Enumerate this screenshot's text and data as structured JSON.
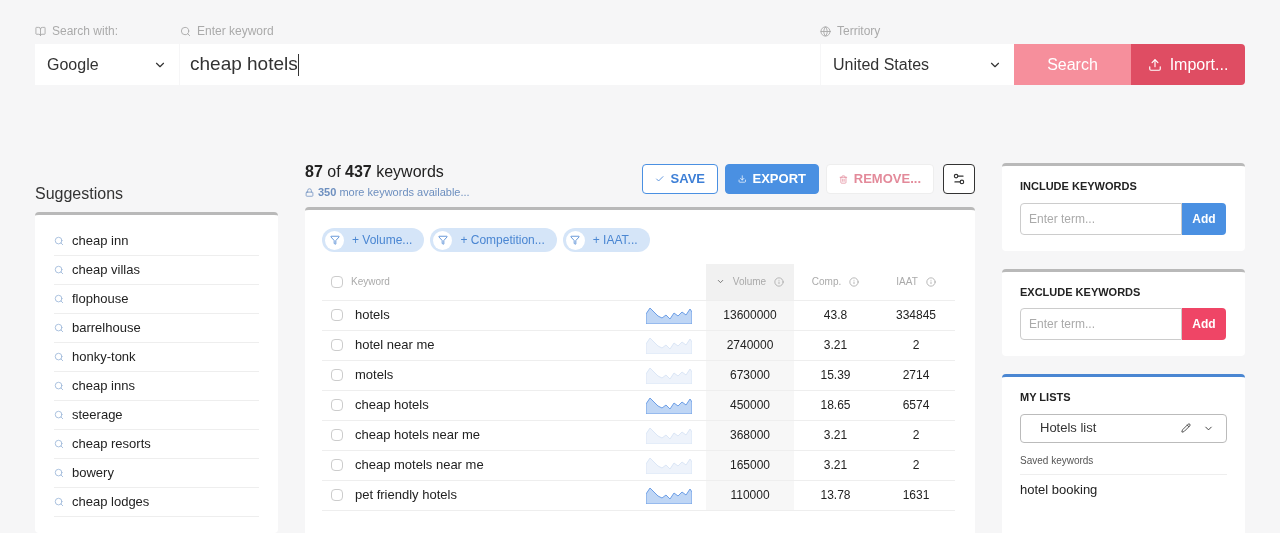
{
  "search_bar": {
    "engine_label": "Search with:",
    "engine": "Google",
    "keyword_label": "Enter keyword",
    "keyword": "cheap hotels",
    "territory_label": "Territory",
    "territory": "United States",
    "search_button": "Search",
    "import_button": "Import..."
  },
  "suggestions": {
    "title": "Suggestions",
    "items": [
      "cheap inn",
      "cheap villas",
      "flophouse",
      "barrelhouse",
      "honky-tonk",
      "cheap inns",
      "steerage",
      "cheap resorts",
      "bowery",
      "cheap lodges"
    ]
  },
  "results": {
    "count": "87",
    "of": "of",
    "total": "437",
    "unit": "keywords",
    "more_count": "350",
    "more_text": "more keywords available...",
    "actions": [
      {
        "kind": "outline",
        "label": "SAVE",
        "disabled": false
      },
      {
        "kind": "solid",
        "label": "EXPORT",
        "disabled": false
      },
      {
        "kind": "delete",
        "label": "REMOVE...",
        "disabled": true
      }
    ],
    "filters": [
      "+ Volume...",
      "+ Competition...",
      "+ IAAT..."
    ],
    "columns": [
      {
        "label": "Keyword",
        "sorted": false
      },
      {
        "label": "Volume",
        "sorted": true
      },
      {
        "label": "Comp.",
        "sorted": false
      },
      {
        "label": "IAAT",
        "sorted": false
      }
    ],
    "rows": [
      {
        "keyword": "hotels",
        "volume": "13600000",
        "comp": "43.8",
        "iaat": "334845",
        "checked": false,
        "trend_highlighted": true
      },
      {
        "keyword": "hotel near me",
        "volume": "2740000",
        "comp": "3.21",
        "iaat": "2",
        "checked": false,
        "trend_highlighted": false
      },
      {
        "keyword": "motels",
        "volume": "673000",
        "comp": "15.39",
        "iaat": "2714",
        "checked": false,
        "trend_highlighted": false
      },
      {
        "keyword": "cheap hotels",
        "volume": "450000",
        "comp": "18.65",
        "iaat": "6574",
        "checked": false,
        "trend_highlighted": true
      },
      {
        "keyword": "cheap hotels near me",
        "volume": "368000",
        "comp": "3.21",
        "iaat": "2",
        "checked": false,
        "trend_highlighted": false
      },
      {
        "keyword": "cheap motels near me",
        "volume": "165000",
        "comp": "3.21",
        "iaat": "2",
        "checked": false,
        "trend_highlighted": false
      },
      {
        "keyword": "pet friendly hotels",
        "volume": "110000",
        "comp": "13.78",
        "iaat": "1631",
        "checked": false,
        "trend_highlighted": true
      }
    ]
  },
  "include": {
    "title": "INCLUDE KEYWORDS",
    "placeholder": "Enter term...",
    "button": "Add"
  },
  "exclude": {
    "title": "EXCLUDE KEYWORDS",
    "placeholder": "Enter term...",
    "button": "Add"
  },
  "my_lists": {
    "title": "MY LISTS",
    "list": "Hotels list",
    "saved_label": "Saved keywords",
    "saved": [
      "hotel booking"
    ]
  }
}
